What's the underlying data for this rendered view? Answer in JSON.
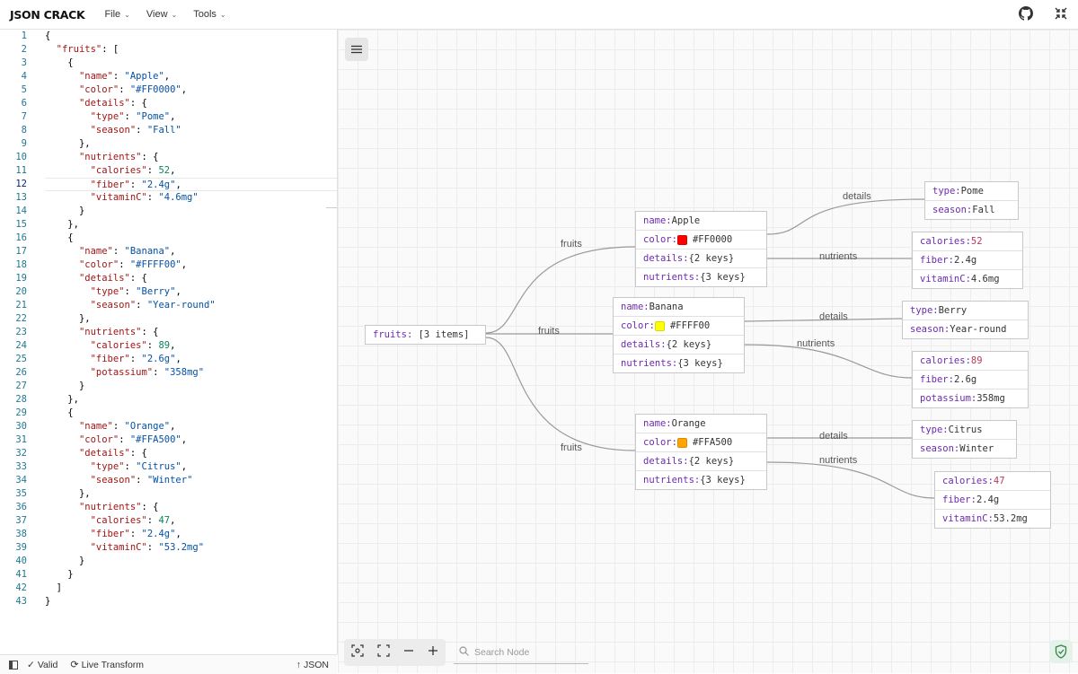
{
  "app": {
    "logo": "JSON CRACK"
  },
  "menu": [
    {
      "label": "File"
    },
    {
      "label": "View"
    },
    {
      "label": "Tools"
    }
  ],
  "editor": {
    "lines": [
      "{",
      "  \"fruits\": [",
      "    {",
      "      \"name\": \"Apple\",",
      "      \"color\": \"#FF0000\",",
      "      \"details\": {",
      "        \"type\": \"Pome\",",
      "        \"season\": \"Fall\"",
      "      },",
      "      \"nutrients\": {",
      "        \"calories\": 52,",
      "        \"fiber\": \"2.4g\",",
      "        \"vitaminC\": \"4.6mg\"",
      "      }",
      "    },",
      "    {",
      "      \"name\": \"Banana\",",
      "      \"color\": \"#FFFF00\",",
      "      \"details\": {",
      "        \"type\": \"Berry\",",
      "        \"season\": \"Year-round\"",
      "      },",
      "      \"nutrients\": {",
      "        \"calories\": 89,",
      "        \"fiber\": \"2.6g\",",
      "        \"potassium\": \"358mg\"",
      "      }",
      "    },",
      "    {",
      "      \"name\": \"Orange\",",
      "      \"color\": \"#FFA500\",",
      "      \"details\": {",
      "        \"type\": \"Citrus\",",
      "        \"season\": \"Winter\"",
      "      },",
      "      \"nutrients\": {",
      "        \"calories\": 47,",
      "        \"fiber\": \"2.4g\",",
      "        \"vitaminC\": \"53.2mg\"",
      "      }",
      "    }",
      "  ]",
      "}"
    ],
    "active_line": 12
  },
  "status": {
    "valid": "Valid",
    "transform": "Live Transform",
    "format": "JSON"
  },
  "graph": {
    "root": {
      "key": "fruits",
      "value": "[3 items]"
    },
    "edge_labels": {
      "fruits": "fruits",
      "details": "details",
      "nutrients": "nutrients"
    },
    "fruits": [
      {
        "name": "Apple",
        "color": "#FF0000",
        "details_summary": "{2 keys}",
        "nutrients_summary": "{3 keys}",
        "details": [
          {
            "k": "type",
            "v": "Pome"
          },
          {
            "k": "season",
            "v": "Fall"
          }
        ],
        "nutrients": [
          {
            "k": "calories",
            "v": "52",
            "num": true
          },
          {
            "k": "fiber",
            "v": "2.4g"
          },
          {
            "k": "vitaminC",
            "v": "4.6mg"
          }
        ]
      },
      {
        "name": "Banana",
        "color": "#FFFF00",
        "details_summary": "{2 keys}",
        "nutrients_summary": "{3 keys}",
        "details": [
          {
            "k": "type",
            "v": "Berry"
          },
          {
            "k": "season",
            "v": "Year-round"
          }
        ],
        "nutrients": [
          {
            "k": "calories",
            "v": "89",
            "num": true
          },
          {
            "k": "fiber",
            "v": "2.6g"
          },
          {
            "k": "potassium",
            "v": "358mg"
          }
        ]
      },
      {
        "name": "Orange",
        "color": "#FFA500",
        "details_summary": "{2 keys}",
        "nutrients_summary": "{3 keys}",
        "details": [
          {
            "k": "type",
            "v": "Citrus"
          },
          {
            "k": "season",
            "v": "Winter"
          }
        ],
        "nutrients": [
          {
            "k": "calories",
            "v": "47",
            "num": true
          },
          {
            "k": "fiber",
            "v": "2.4g"
          },
          {
            "k": "vitaminC",
            "v": "53.2mg"
          }
        ]
      }
    ]
  },
  "search": {
    "placeholder": "Search Node"
  }
}
